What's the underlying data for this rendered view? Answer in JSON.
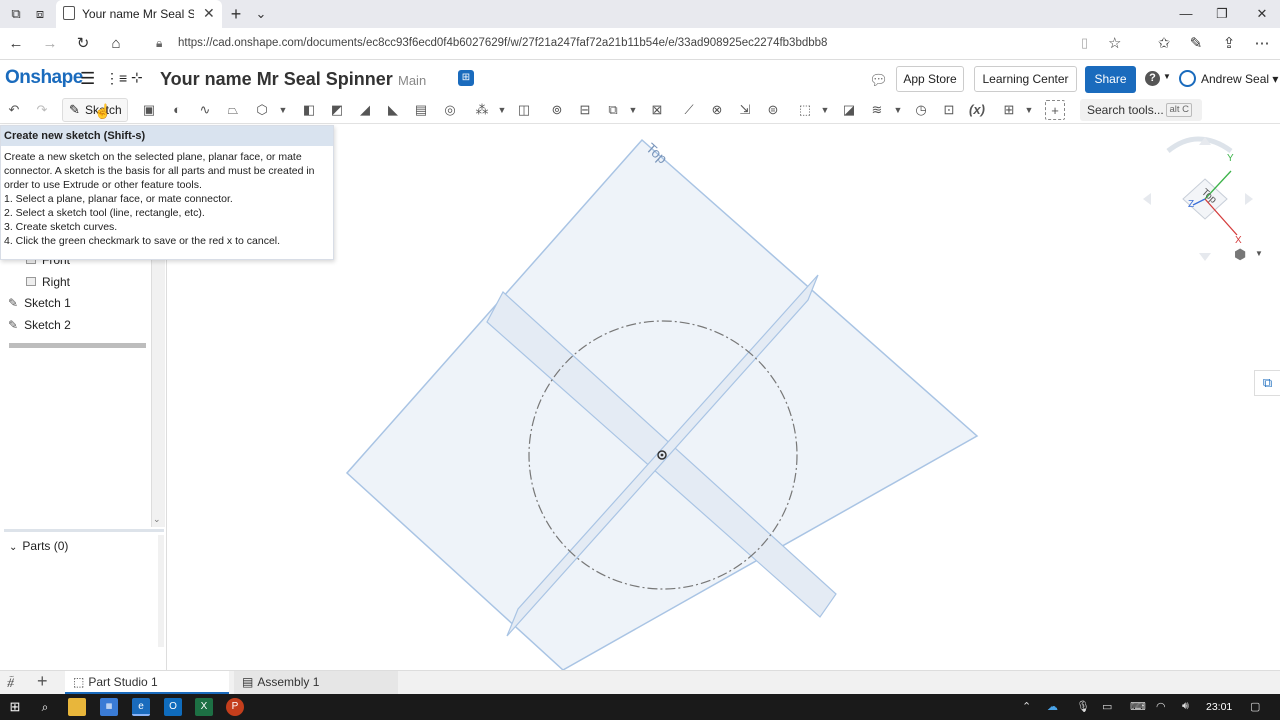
{
  "browser": {
    "tab_title": "Your name Mr Seal Spin",
    "url": "https://cad.onshape.com/documents/ec8cc93f6ecd0f4b6027629f/w/27f21a247faf72a21b11b54e/e/33ad908925ec2274fb3bdbb8"
  },
  "header": {
    "logo": "Onshape",
    "doc_name": "Your name Mr Seal Spinner",
    "branch": "Main",
    "app_store": "App Store",
    "learning_center": "Learning Center",
    "share": "Share",
    "user": "Andrew Seal"
  },
  "toolbar": {
    "sketch_label": "Sketch",
    "search_label": "Search tools...",
    "search_shortcut_a": "alt",
    "search_shortcut_b": "C"
  },
  "tooltip": {
    "title": "Create new sketch (Shift-s)",
    "desc": "Create a new sketch on the selected plane, planar face, or mate connector. A sketch is the basis for all parts and must be created in order to use Extrude or other feature tools.",
    "steps": [
      "1.  Select a plane, planar face, or mate connector.",
      "2.  Select a sketch tool (line, rectangle, etc).",
      "3.  Create sketch curves.",
      "4.  Click the green checkmark to save or the red x to cancel."
    ]
  },
  "tree": {
    "front": "Front",
    "right": "Right",
    "sketch1": "Sketch 1",
    "sketch2": "Sketch 2",
    "parts": "Parts (0)"
  },
  "viewport": {
    "plane_label": "Top",
    "viewcube_label": "Top",
    "axis_x": "X",
    "axis_y": "Y",
    "axis_z": "Z"
  },
  "bottom_tabs": {
    "part_studio": "Part Studio 1",
    "assembly": "Assembly 1"
  },
  "taskbar": {
    "time": "23:01"
  },
  "colors": {
    "brand": "#1a6bbd",
    "plane_fill": "#eef3f9",
    "plane_stroke": "#a9c4e4"
  }
}
